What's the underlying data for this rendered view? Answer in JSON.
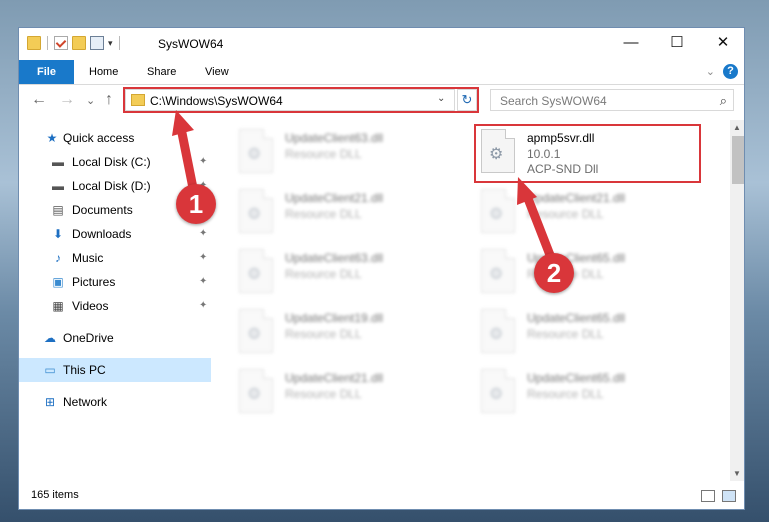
{
  "window": {
    "title": "SysWOW64",
    "min_icon": "—",
    "max_icon": "☐",
    "close_icon": "✕",
    "qat_dropdown": "▾"
  },
  "ribbon": {
    "tabs": [
      "File",
      "Home",
      "Share",
      "View"
    ],
    "collapse_icon": "⌄",
    "help_icon": "?"
  },
  "nav": {
    "back": "←",
    "forward": "→",
    "recent": "⌄",
    "up": "↑",
    "address": "C:\\Windows\\SysWOW64",
    "address_dropdown": "⌄",
    "refresh": "↻",
    "search_placeholder": "Search SysWOW64",
    "search_icon": "⌕"
  },
  "sidebar": {
    "items": [
      {
        "label": "Quick access",
        "icon": "★",
        "icon_name": "star-icon"
      },
      {
        "label": "Local Disk (C:)",
        "icon": "▬",
        "icon_name": "drive-icon",
        "pinned": true
      },
      {
        "label": "Local Disk (D:)",
        "icon": "▬",
        "icon_name": "drive-icon",
        "pinned": true
      },
      {
        "label": "Documents",
        "icon": "▤",
        "icon_name": "documents-icon",
        "pinned": true
      },
      {
        "label": "Downloads",
        "icon": "⬇",
        "icon_name": "download-icon",
        "pinned": true
      },
      {
        "label": "Music",
        "icon": "♪",
        "icon_name": "music-icon",
        "pinned": true
      },
      {
        "label": "Pictures",
        "icon": "▣",
        "icon_name": "pictures-icon",
        "pinned": true
      },
      {
        "label": "Videos",
        "icon": "▦",
        "icon_name": "videos-icon",
        "pinned": true
      },
      {
        "label": "OneDrive",
        "icon": "☁",
        "icon_name": "cloud-icon"
      },
      {
        "label": "This PC",
        "icon": "▭",
        "icon_name": "computer-icon",
        "selected": true
      },
      {
        "label": "Network",
        "icon": "⊞",
        "icon_name": "network-icon"
      }
    ],
    "pin_icon": "✦"
  },
  "files": {
    "highlighted": {
      "name": "apmp5svr.dll",
      "version": "10.0.1",
      "company": "ACP-SND Dll"
    },
    "left_column": [
      {
        "name": "UpdateClient63.dll",
        "type": "Resource DLL"
      },
      {
        "name": "UpdateClient21.dll",
        "type": "Resource DLL"
      },
      {
        "name": "UpdateClient63.dll",
        "type": "Resource DLL"
      },
      {
        "name": "UpdateClient19.dll",
        "type": "Resource DLL"
      },
      {
        "name": "UpdateClient21.dll",
        "type": "Resource DLL"
      }
    ],
    "right_column": [
      {
        "name": "UpdateClient21.dll",
        "type": "Resource DLL"
      },
      {
        "name": "UpdateClient65.dll",
        "type": "Resource DLL"
      },
      {
        "name": "UpdateClient65.dll",
        "type": "Resource DLL"
      },
      {
        "name": "UpdateClient65.dll",
        "type": "Resource DLL"
      }
    ],
    "gear_icon": "⚙"
  },
  "status": {
    "count": "165 items"
  },
  "scroll": {
    "up": "▲",
    "down": "▼"
  },
  "annotations": {
    "badge1": "1",
    "badge2": "2",
    "color": "#d9363a"
  }
}
